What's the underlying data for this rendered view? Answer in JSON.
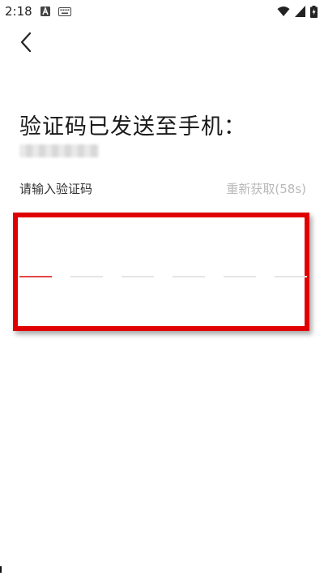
{
  "status_bar": {
    "time": "2:18",
    "icons": [
      "a-notification-icon",
      "keyboard-icon"
    ],
    "right_icons": [
      "wifi-icon",
      "signal-icon",
      "battery-charging-icon"
    ]
  },
  "header": {
    "back_icon": "chevron-left-icon"
  },
  "verify": {
    "title": "验证码已发送至手机：",
    "phone_number_masked": true,
    "prompt": "请输入验证码",
    "resend_label": "重新获取(58s)"
  },
  "code_input": {
    "length": 6,
    "active_index": 0,
    "highlight_color": "#e00000",
    "active_slot_color": "#e34848",
    "inactive_slot_color": "#e5e5e5"
  },
  "colors": {
    "text": "#1a1a1a",
    "muted": "#b8b8b8"
  }
}
